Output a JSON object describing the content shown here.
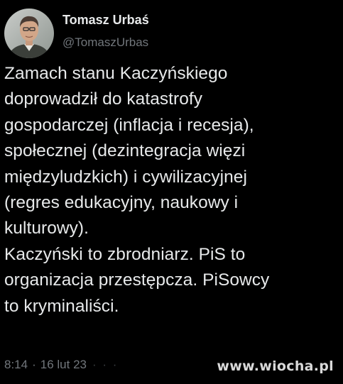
{
  "tweet": {
    "author": {
      "display_name": "Tomasz Urbaś",
      "handle": "@TomaszUrbas",
      "avatar_icon": "profile-photo"
    },
    "text": "Zamach stanu Kaczyńskiego\ndoprowadził do katastrofy\ngospodarczej (inflacja i recesja),\nspołecznej (dezintegracja więzi\nmiędzyludzkich) i cywilizacyjnej\n(regres edukacyjny, naukowy i\nkulturowy).\nKaczyński to zbrodniarz. PiS to\norganizacja przestępcza. PiSowcy\nto kryminaliści.",
    "time": "8:14",
    "separator": "·",
    "date": "16 lut 23",
    "faded_tail": "· · ·"
  },
  "watermark": {
    "text": "www.wiocha.pl"
  },
  "colors": {
    "background": "#000000",
    "primary_text": "#e7e9ea",
    "secondary_text": "#71767b"
  }
}
